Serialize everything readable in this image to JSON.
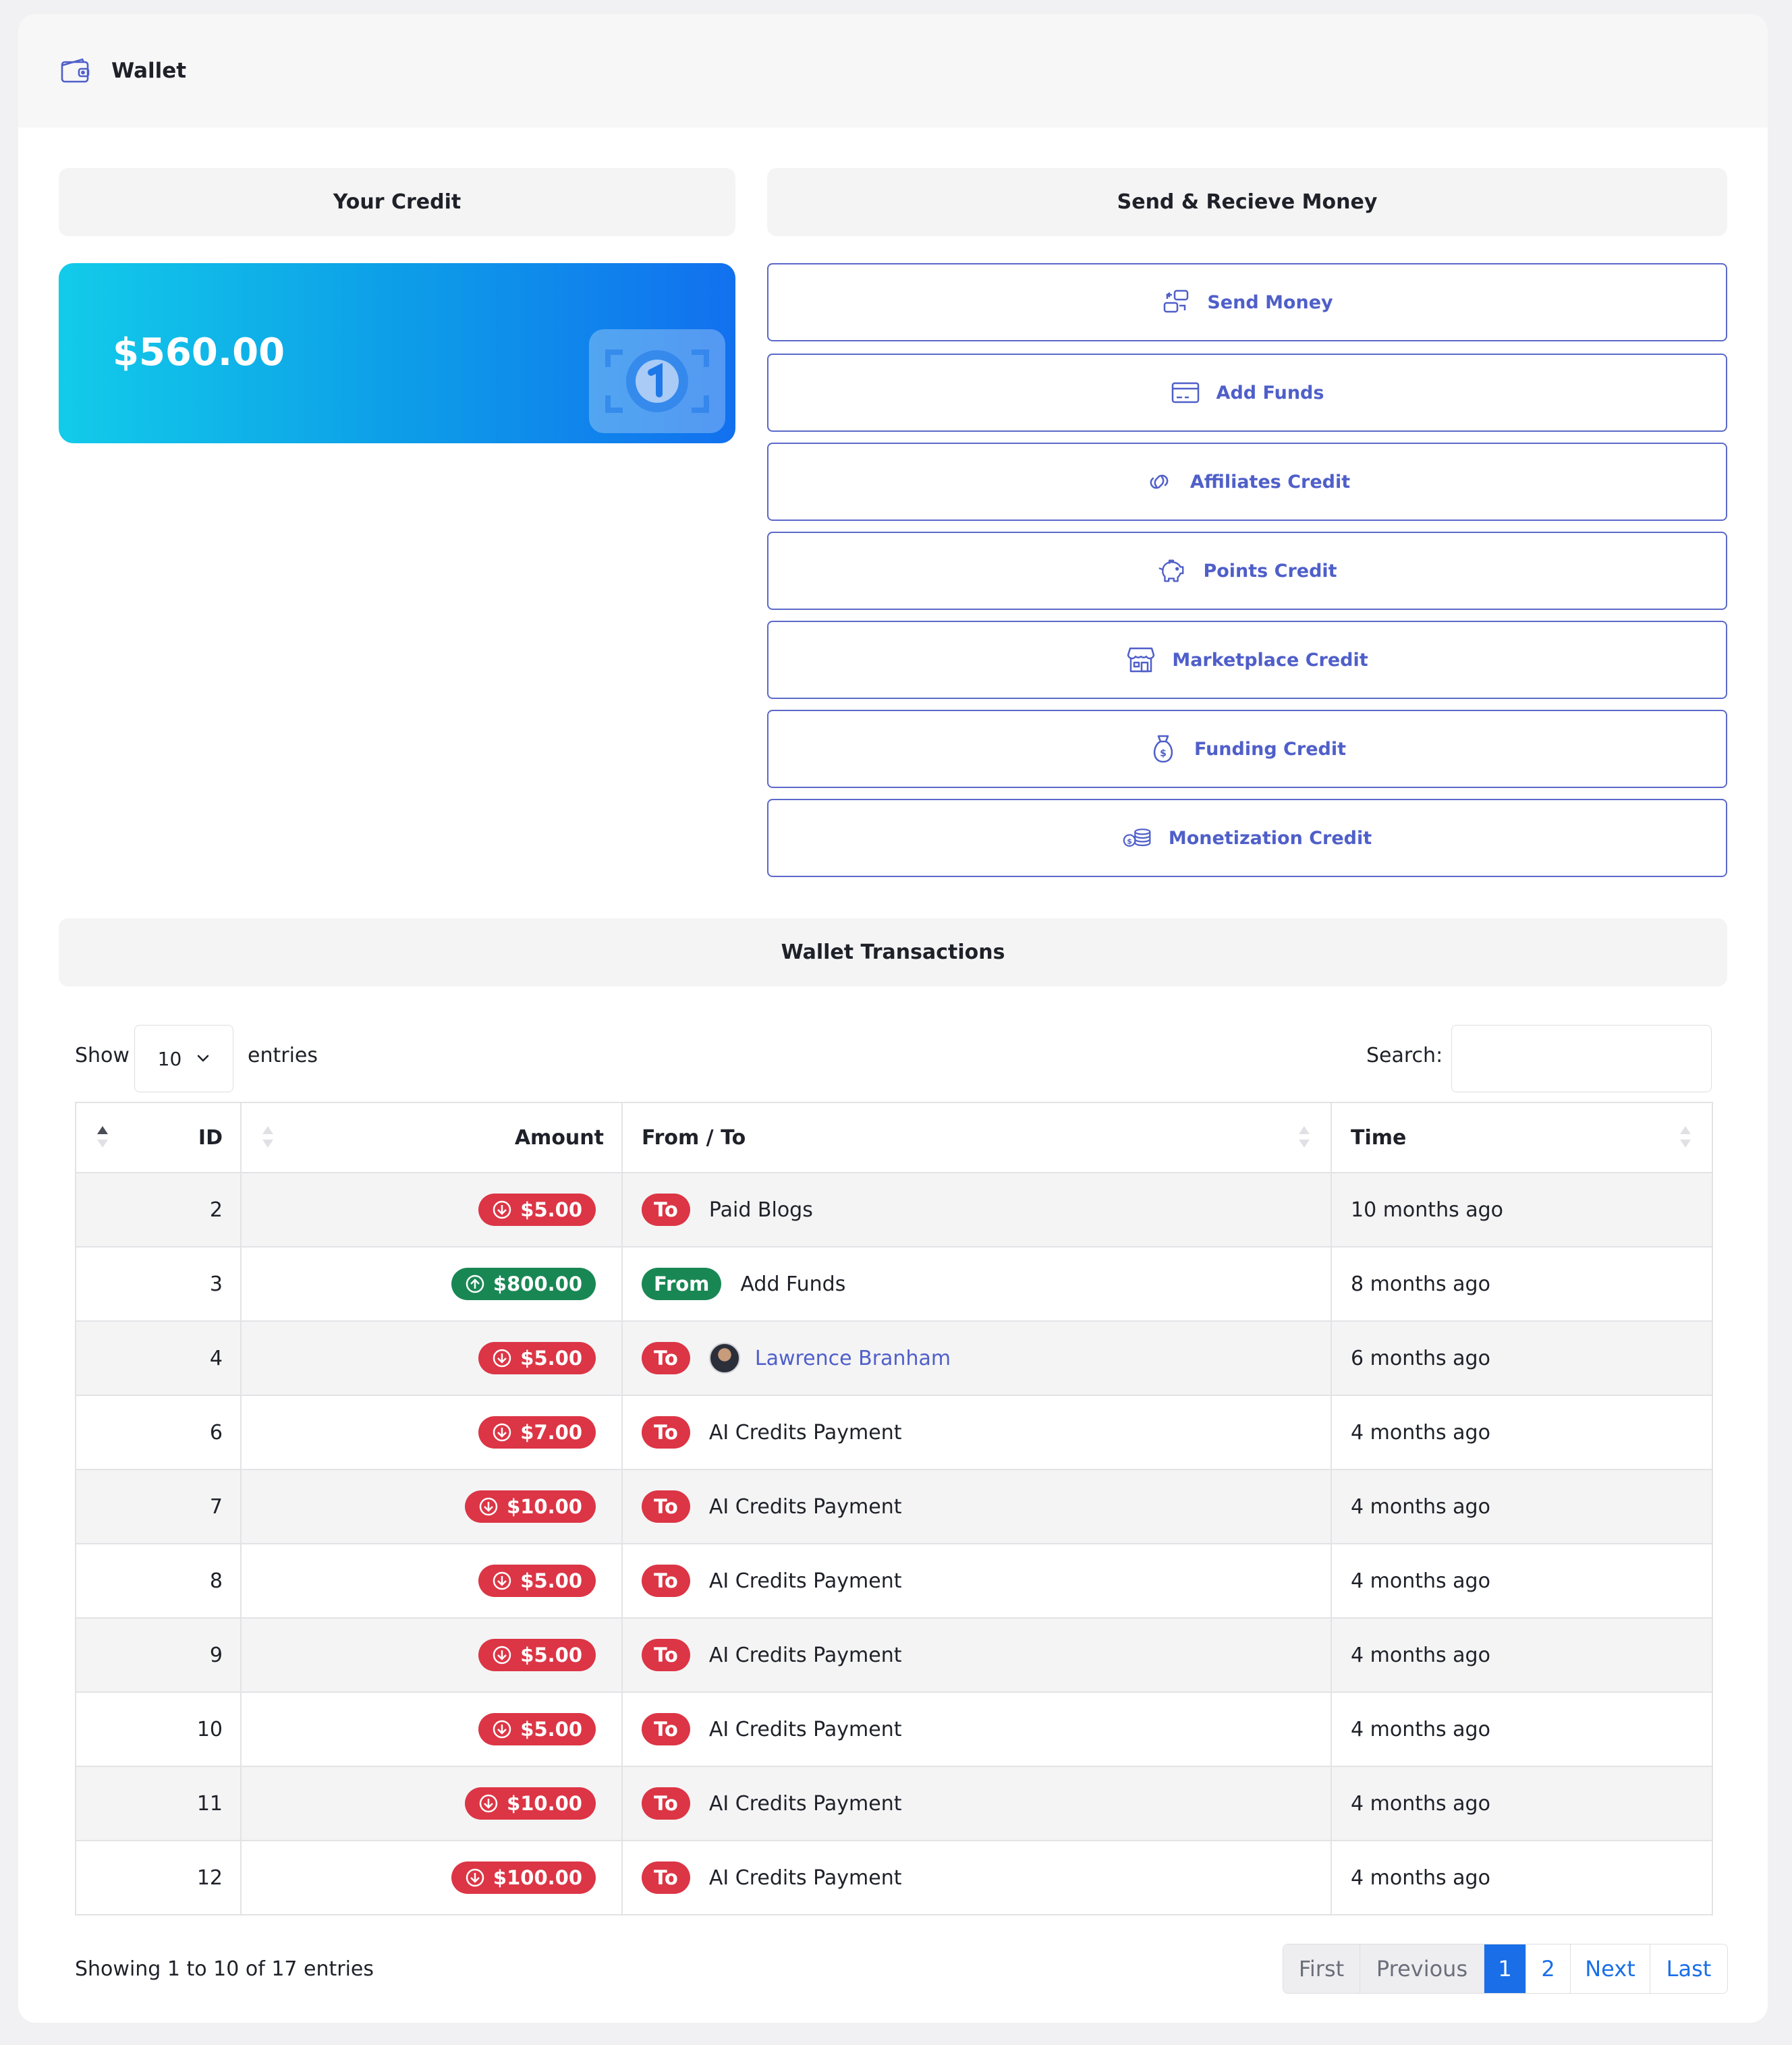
{
  "header": {
    "title": "Wallet",
    "icon": "wallet-icon"
  },
  "credit": {
    "section_title": "Your Credit",
    "amount": "$560.00",
    "icon": "cash-icon"
  },
  "send": {
    "section_title": "Send & Recieve Money",
    "buttons": [
      {
        "label": "Send Money",
        "icon": "send-money-icon"
      },
      {
        "label": "Add Funds",
        "icon": "card-icon"
      },
      {
        "label": "Affiliates Credit",
        "icon": "link-icon"
      },
      {
        "label": "Points Credit",
        "icon": "piggy-bank-icon"
      },
      {
        "label": "Marketplace Credit",
        "icon": "store-icon"
      },
      {
        "label": "Funding Credit",
        "icon": "money-bag-icon"
      },
      {
        "label": "Monetization Credit",
        "icon": "coins-icon"
      }
    ]
  },
  "transactions": {
    "section_title": "Wallet Transactions",
    "show_label": "Show",
    "entries_value": "10",
    "entries_label": "entries",
    "search_label": "Search:",
    "search_value": "",
    "columns": {
      "id": "ID",
      "amount": "Amount",
      "from_to": "From / To",
      "time": "Time"
    },
    "rows": [
      {
        "id": "2",
        "amount": "$5.00",
        "direction": "To",
        "name": "Paid Blogs",
        "time": "10 months ago"
      },
      {
        "id": "3",
        "amount": "$800.00",
        "direction": "From",
        "name": "Add Funds",
        "time": "8 months ago"
      },
      {
        "id": "4",
        "amount": "$5.00",
        "direction": "To",
        "name": "Lawrence Branham",
        "time": "6 months ago"
      },
      {
        "id": "6",
        "amount": "$7.00",
        "direction": "To",
        "name": "AI Credits Payment",
        "time": "4 months ago"
      },
      {
        "id": "7",
        "amount": "$10.00",
        "direction": "To",
        "name": "AI Credits Payment",
        "time": "4 months ago"
      },
      {
        "id": "8",
        "amount": "$5.00",
        "direction": "To",
        "name": "AI Credits Payment",
        "time": "4 months ago"
      },
      {
        "id": "9",
        "amount": "$5.00",
        "direction": "To",
        "name": "AI Credits Payment",
        "time": "4 months ago"
      },
      {
        "id": "10",
        "amount": "$5.00",
        "direction": "To",
        "name": "AI Credits Payment",
        "time": "4 months ago"
      },
      {
        "id": "11",
        "amount": "$10.00",
        "direction": "To",
        "name": "AI Credits Payment",
        "time": "4 months ago"
      },
      {
        "id": "12",
        "amount": "$100.00",
        "direction": "To",
        "name": "AI Credits Payment",
        "time": "4 months ago"
      }
    ],
    "showing_text": "Showing 1 to 10 of 17 entries",
    "pagination": {
      "first": "First",
      "previous": "Previous",
      "page1": "1",
      "page2": "2",
      "next": "Next",
      "last": "Last"
    }
  },
  "colors": {
    "accent": "#4f5fc9",
    "debit": "#dc3545",
    "credit": "#198754",
    "card_gradient_start": "#12cbe9",
    "card_gradient_end": "#1270ef",
    "page_active": "#1a6fe8"
  }
}
